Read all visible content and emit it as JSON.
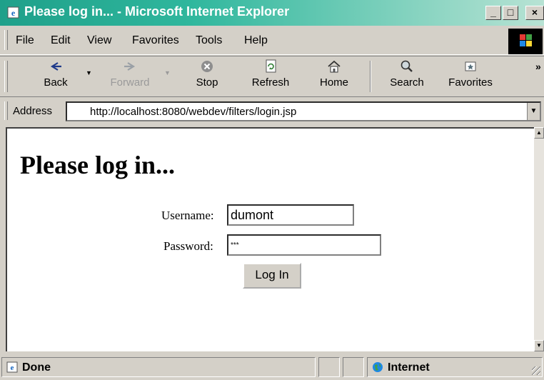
{
  "window": {
    "title": "Please log in... - Microsoft Internet Explorer",
    "controls": {
      "minimize": "_",
      "maximize": "□",
      "close": "×"
    }
  },
  "menu": {
    "items": [
      {
        "label": "File"
      },
      {
        "label": "Edit"
      },
      {
        "label": "View"
      },
      {
        "label": "Favorites"
      },
      {
        "label": "Tools"
      },
      {
        "label": "Help"
      }
    ]
  },
  "toolbar": {
    "buttons": [
      {
        "label": "Back",
        "icon": "back-arrow-icon",
        "enabled": true
      },
      {
        "label": "Forward",
        "icon": "forward-arrow-icon",
        "enabled": false
      },
      {
        "label": "Stop",
        "icon": "stop-icon",
        "enabled": true
      },
      {
        "label": "Refresh",
        "icon": "refresh-icon",
        "enabled": true
      },
      {
        "label": "Home",
        "icon": "home-icon",
        "enabled": true
      },
      {
        "label": "Search",
        "icon": "search-icon",
        "enabled": true
      },
      {
        "label": "Favorites",
        "icon": "favorites-icon",
        "enabled": true
      }
    ],
    "more": "»"
  },
  "address": {
    "label": "Address",
    "url": "http://localhost:8080/webdev/filters/login.jsp"
  },
  "page": {
    "heading": "Please log in...",
    "username_label": "Username:",
    "username_value": "dumont",
    "password_label": "Password:",
    "password_value": "***",
    "login_button": "Log In"
  },
  "status": {
    "text": "Done",
    "zone": "Internet"
  },
  "colors": {
    "titlebar_start": "#1fa08a",
    "titlebar_end": "#b8e3d4",
    "chrome": "#d4d0c8"
  }
}
